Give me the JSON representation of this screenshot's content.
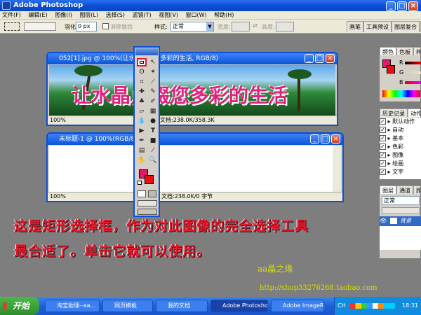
{
  "window": {
    "title": "Adobe Photoshop"
  },
  "menu": [
    "文件(F)",
    "编辑(E)",
    "图像(I)",
    "图层(L)",
    "选择(S)",
    "滤镜(T)",
    "视图(V)",
    "窗口(W)",
    "帮助(H)"
  ],
  "options": {
    "feather_label": "羽化:",
    "feather_value": "0 px",
    "antialias_label": "消除锯齿",
    "style_label": "样式:",
    "style_value": "正常",
    "width_label": "宽度:",
    "height_label": "高度:",
    "tabs": [
      "画笔",
      "工具预设",
      "图层复合"
    ]
  },
  "doc1": {
    "title": "052[1].jpg @ 100%(让水晶点缀您多彩的生活, RGB/8)",
    "banner_text": "让水晶点缀您多彩的生活",
    "zoom": "100%",
    "status": "文档:238.0K/358.3K"
  },
  "doc2": {
    "title": "未标题-1 @ 100%(RGB/8)",
    "zoom": "100%",
    "status": "文档:238.0K/0 字节"
  },
  "color_panel": {
    "tabs": [
      "颜色",
      "色板",
      "样式"
    ],
    "channels": [
      "R",
      "G",
      "B"
    ],
    "foreground": "#e8166e",
    "background": "#e80e14"
  },
  "history_panel": {
    "tabs": [
      "历史记录",
      "动作"
    ],
    "items": [
      "默认动作",
      "自动",
      "基本",
      "色彩",
      "图像",
      "绘画",
      "文字"
    ]
  },
  "layers_panel": {
    "tabs": [
      "图层",
      "通道",
      "路径"
    ],
    "blend": "正常",
    "layer_name": "背景"
  },
  "caption": {
    "line1": "这是矩形选择框，作为对此图像的完全选择工具",
    "line2": "最合适了。单击它就可以使用。"
  },
  "watermark": {
    "name": "aa晶之缘",
    "url": "http://shop33276268.taobao.com"
  },
  "taskbar": {
    "start": "开始",
    "tasks": [
      "淘宝助理--aa...",
      "网页模板",
      "我的文档",
      "Adobe Photoshop",
      "Adobe ImageR..."
    ],
    "ime": "CH",
    "clock": "18:31"
  },
  "colors": {
    "titlebar": "#0a4fd6",
    "caption": "#e8162b",
    "watermark": "#d8e000"
  }
}
